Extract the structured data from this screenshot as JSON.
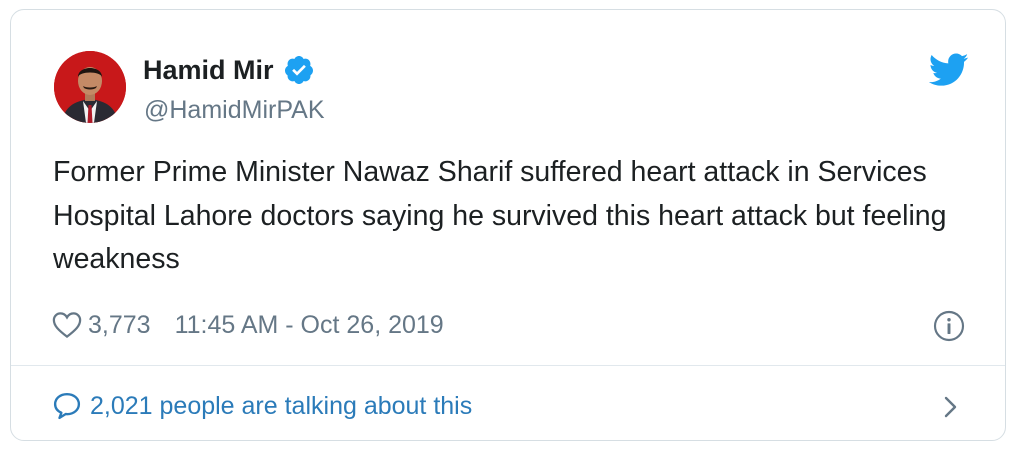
{
  "tweet": {
    "author_name": "Hamid Mir",
    "author_handle": "@HamidMirPAK",
    "text": "Former Prime Minister Nawaz Sharif suffered heart attack in Services Hospital Lahore doctors saying he survived this heart attack but feeling weakness",
    "likes": "3,773",
    "timestamp": "11:45 AM - Oct 26, 2019",
    "conversation": "2,021 people are talking about this"
  },
  "icons": {
    "verified": "verified-badge-icon",
    "bird": "twitter-bird-icon",
    "like": "heart-icon",
    "info": "info-icon",
    "reply": "speech-bubble-icon",
    "chevron": "chevron-right-icon"
  },
  "colors": {
    "brand_blue": "#1da1f2",
    "link_blue": "#2b7bb9",
    "secondary_text": "#657786",
    "primary_text": "#1c2022"
  }
}
